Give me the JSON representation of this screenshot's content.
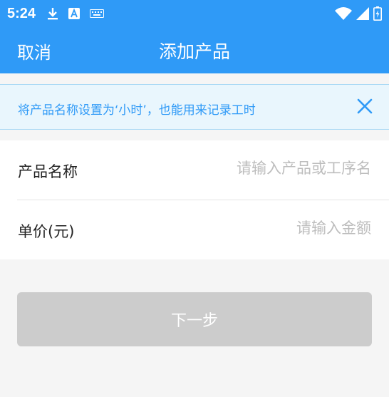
{
  "status_bar": {
    "time": "5:24",
    "left_icons": [
      "download-icon",
      "font-icon",
      "keyboard-icon"
    ],
    "right_icons": [
      "wifi-icon",
      "signal-icon",
      "battery-charging-icon"
    ]
  },
  "toolbar": {
    "cancel_label": "取消",
    "title": "添加产品"
  },
  "banner": {
    "text": "将产品名称设置为‘小时’，也能用来记录工时",
    "close_icon": "close-icon"
  },
  "form": {
    "product_name": {
      "label": "产品名称",
      "value": "",
      "placeholder": "请输入产品或工序名"
    },
    "unit_price": {
      "label": "单价(元)",
      "value": "",
      "placeholder": "请输入金额"
    }
  },
  "next_button": {
    "label": "下一步"
  },
  "colors": {
    "primary": "#2f9af7",
    "banner_bg": "#e9f6fd",
    "banner_text": "#2f9af7",
    "disabled_button": "#cccccc",
    "page_bg": "#f5f5f5"
  }
}
